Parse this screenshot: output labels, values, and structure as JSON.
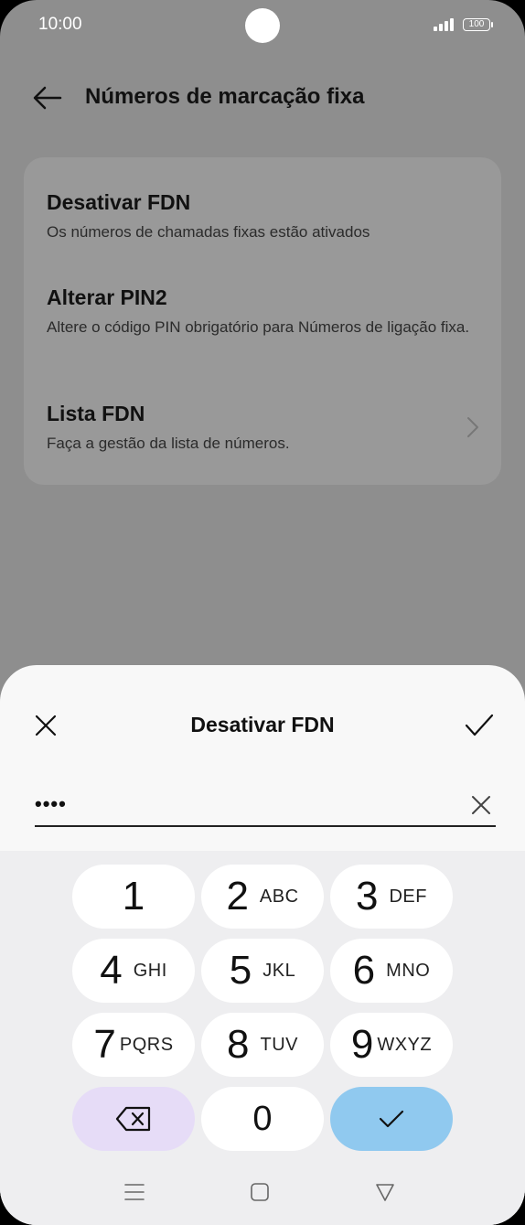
{
  "status": {
    "time": "10:00",
    "battery": "100"
  },
  "header": {
    "title": "Números de marcação fixa"
  },
  "menu": {
    "items": [
      {
        "title": "Desativar FDN",
        "subtitle": "Os números de chamadas fixas estão ativados"
      },
      {
        "title": "Alterar PIN2",
        "subtitle": "Altere o código PIN obrigatório para Números de ligação fixa."
      },
      {
        "title": "Lista FDN",
        "subtitle": "Faça a gestão da lista de números."
      }
    ]
  },
  "dialog": {
    "title": "Desativar FDN",
    "pin_value": "••••"
  },
  "keypad": {
    "keys": [
      {
        "num": "1",
        "letters": ""
      },
      {
        "num": "2",
        "letters": "ABC"
      },
      {
        "num": "3",
        "letters": "DEF"
      },
      {
        "num": "4",
        "letters": "GHI"
      },
      {
        "num": "5",
        "letters": "JKL"
      },
      {
        "num": "6",
        "letters": "MNO"
      },
      {
        "num": "7",
        "letters": "PQRS"
      },
      {
        "num": "8",
        "letters": "TUV"
      },
      {
        "num": "9",
        "letters": "WXYZ"
      },
      {
        "num": "0",
        "letters": ""
      }
    ]
  },
  "colors": {
    "dim_background": "#8e8e8e",
    "card": "#999999",
    "sheet": "#f8f8f8",
    "keypad": "#eeeef0",
    "delete_key": "#e6dcf7",
    "done_key": "#90c9ef"
  },
  "icons": {
    "back": "arrow-left-icon",
    "chevron": "chevron-right-icon",
    "close": "close-icon",
    "confirm": "check-icon",
    "delete": "backspace-icon",
    "nav": [
      "menu-icon",
      "home-icon",
      "back-triangle-icon"
    ]
  }
}
